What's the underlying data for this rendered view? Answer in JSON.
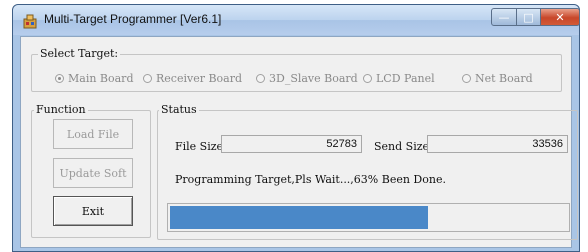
{
  "window": {
    "title": "Multi-Target Programmer [Ver6.1]",
    "controls": {
      "minimize": "—",
      "maximize": "□",
      "close": "✕"
    }
  },
  "select_target": {
    "legend": "Select Target:",
    "options": [
      {
        "label": "Main Board",
        "selected": true
      },
      {
        "label": "Receiver Board",
        "selected": false
      },
      {
        "label": "3D_Slave Board",
        "selected": false
      },
      {
        "label": "LCD Panel",
        "selected": false
      },
      {
        "label": "Net Board",
        "selected": false
      }
    ]
  },
  "function": {
    "legend": "Function",
    "buttons": [
      {
        "label": "Load File",
        "enabled": false
      },
      {
        "label": "Update Soft",
        "enabled": false
      },
      {
        "label": "Exit",
        "enabled": true
      }
    ]
  },
  "status": {
    "legend": "Status",
    "file_size_label": "File Size:",
    "file_size_value": "52783",
    "send_size_label": "Send Size",
    "send_size_value": "33536",
    "message": "Programming Target,Pls Wait...,63% Been Done.",
    "progress_fraction": 0.65
  },
  "colors": {
    "progress_fill": "#4a88c8",
    "titlebar": "#b6cdec",
    "close_button": "#c8472a"
  }
}
